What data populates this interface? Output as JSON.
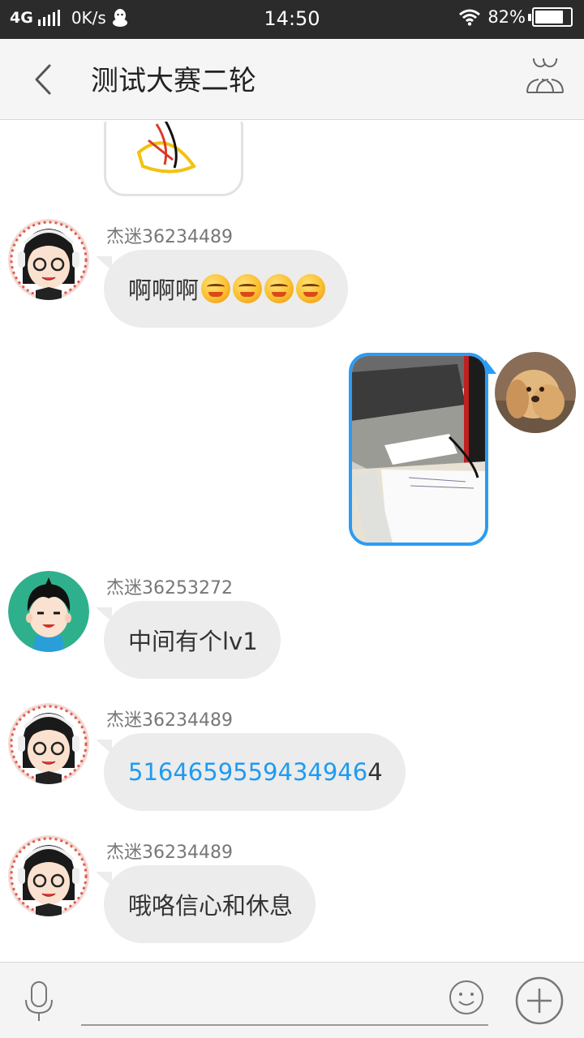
{
  "status_bar": {
    "network": "4G",
    "speed": "0K/s",
    "time": "14:50",
    "battery": "82%",
    "battery_level": 0.82
  },
  "header": {
    "title": "测试大赛二轮",
    "back_icon": "chevron-left-icon",
    "group_icon": "group-members-icon"
  },
  "messages": [
    {
      "sender": "杰迷36234489",
      "text": "啊啊啊",
      "emoji_count": 4,
      "avatar": "girl-headphones"
    },
    {
      "type": "image",
      "outgoing": true,
      "avatar": "dog"
    },
    {
      "sender": "杰迷36253272",
      "text": "中间有个lv1",
      "avatar": "boy"
    },
    {
      "sender": "杰迷36234489",
      "link_text": "5164659559434946",
      "text_suffix": "4",
      "avatar": "girl-headphones"
    },
    {
      "sender": "杰迷36234489",
      "text": "哦咯信心和休息",
      "avatar": "girl-headphones"
    }
  ],
  "input_bar": {
    "placeholder": "",
    "mic_icon": "microphone-icon",
    "emoji_icon": "smiley-icon",
    "plus_icon": "plus-circle-icon"
  },
  "colors": {
    "bubble": "#ececec",
    "link": "#1e9bf0",
    "image_border": "#2a9cf5",
    "status_bar": "#2b2b2b",
    "header": "#f5f5f5"
  }
}
